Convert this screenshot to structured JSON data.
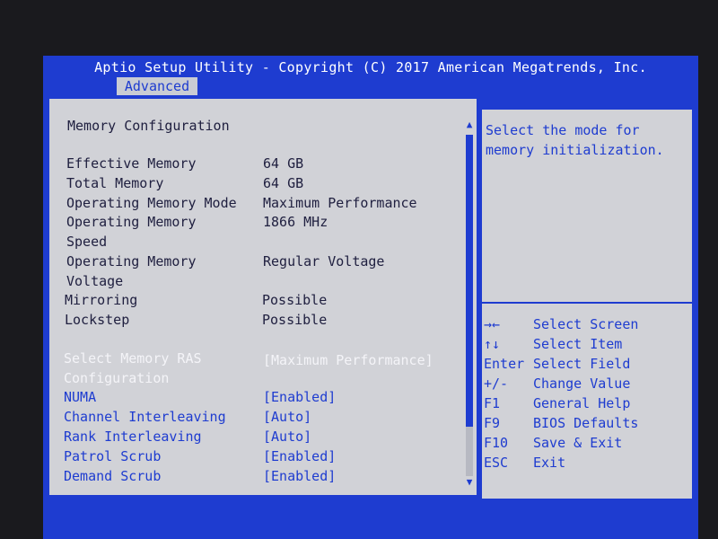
{
  "header": {
    "title": "Aptio Setup Utility - Copyright (C) 2017 American Megatrends, Inc.",
    "tab": "Advanced"
  },
  "main": {
    "section_title": "Memory Configuration",
    "info": [
      {
        "label": "Effective Memory",
        "value": "64 GB"
      },
      {
        "label": "Total Memory",
        "value": "64 GB"
      },
      {
        "label": "Operating Memory Mode",
        "value": "Maximum Performance"
      },
      {
        "label": "Operating Memory",
        "label2": "Speed",
        "value": "1866 MHz"
      },
      {
        "label": "Operating Memory",
        "label2": "Voltage",
        "value": "Regular Voltage"
      },
      {
        "label": "Mirroring",
        "value": "Possible"
      },
      {
        "label": "Lockstep",
        "value": "Possible"
      }
    ],
    "options": [
      {
        "label": "Select Memory RAS",
        "label2": "Configuration",
        "value": "[Maximum Performance]"
      },
      {
        "label": "NUMA",
        "value": "[Enabled]"
      },
      {
        "label": "Channel Interleaving",
        "value": "[Auto]"
      },
      {
        "label": "Rank Interleaving",
        "value": "[Auto]"
      },
      {
        "label": "Patrol Scrub",
        "value": "[Enabled]"
      },
      {
        "label": "Demand Scrub",
        "value": "[Enabled]"
      }
    ]
  },
  "help": {
    "line1": "Select the mode for",
    "line2": "memory initialization."
  },
  "keys": [
    {
      "key": "→←",
      "action": "Select Screen"
    },
    {
      "key": "↑↓",
      "action": "Select Item"
    },
    {
      "key": "Enter",
      "action": "Select Field"
    },
    {
      "key": "+/-",
      "action": "Change Value"
    },
    {
      "key": "F1",
      "action": "General Help"
    },
    {
      "key": "F9",
      "action": "BIOS Defaults"
    },
    {
      "key": "F10",
      "action": "Save & Exit"
    },
    {
      "key": "ESC",
      "action": "Exit"
    }
  ],
  "scroll": {
    "up_glyph": "▲",
    "down_glyph": "▼"
  },
  "colors": {
    "bios_blue": "#1e3cd0",
    "panel_gray": "#d1d2d7",
    "text_dark": "#202040",
    "selected_white": "#f4f4f8"
  }
}
